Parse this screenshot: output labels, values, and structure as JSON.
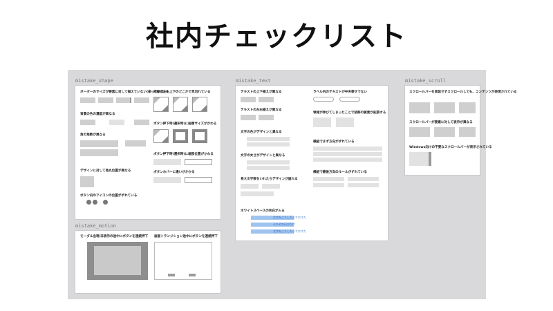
{
  "page_title": "社内チェックリスト",
  "frames": {
    "shape": {
      "label": "mistake_shape",
      "headings": [
        "ボーダーのサイズが要素に対して揃えていない(揃っていない)",
        "背景の色の濃度が異なる",
        "角の角数が異なる",
        "デザインに対して角丸位置が異なる",
        "ボタン内のアイコンの位置がずれている",
        "枠線が左右上下のどこかで見切れている",
        "ボタン押下時(選択時)に画像サイズがかわる",
        "ボタン押下時(選択時)に端部位置がかわる",
        "ボタンホバーに違いがかかる"
      ]
    },
    "motion": {
      "label": "mistake_motion",
      "headings": [
        "モーダル出現/非表示の途中にボタンを連続押下",
        "画面トランジション途中にボタンを連続押下"
      ]
    },
    "text": {
      "label": "mistake_text",
      "headings": [
        "テキストの上下揃えが異なる",
        "テキストの左右揃えが異なる",
        "文字の色がデザインと異なる",
        "文字の太さがデザインと異なる",
        "長大文字数をいれたらデザインが崩れる",
        "ホワイトスペースの余白が入る",
        "ラベル内のテキストが中央寄せでない",
        "領域が伸びてしまったことで装飾の要素が拡張する",
        "横組でまず方向がずれている",
        "横組で最後方向のルールがずれている"
      ],
      "blue_labels": [
        "文字をこうしたらでかけた",
        "それぞれ行がだけ",
        "文字をこうしたらでかけた"
      ]
    },
    "scroll": {
      "label": "mistake_scroll",
      "headings": [
        "スクロールバーを実装せずスクロールしても、コンテンツが表現されている",
        "スクロールバーが要素に対して表示が異なる",
        "Windows向けの不要なスクロールバーが表示されている"
      ]
    }
  }
}
